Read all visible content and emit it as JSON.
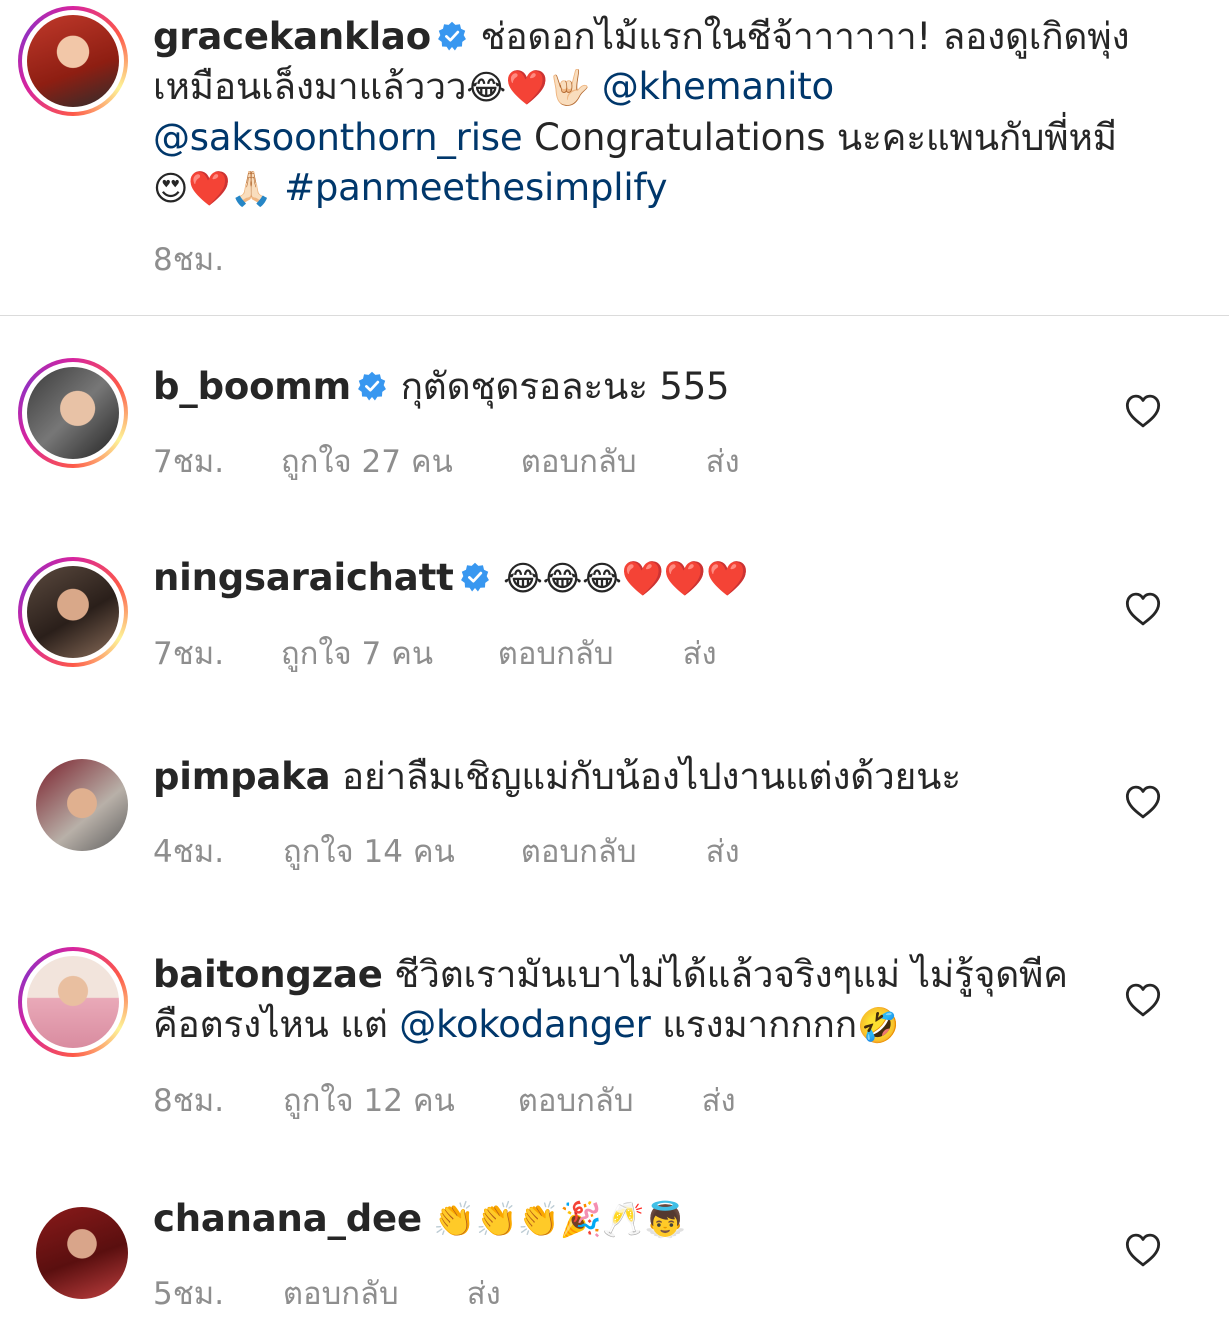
{
  "caption": {
    "username": "gracekanklao",
    "verified": true,
    "text_part1": "ช่อดอกไม้แรกในชีจ้าาาาาา! ลองดูเกิดพุ่งเหมือนเล็งมาแล้ววว",
    "emoji_part1": "😂❤️🤟🏻",
    "mention1": "@khemanito",
    "mention2": "@saksoonthorn_rise",
    "text_part2": "Congratulations นะคะแพนกับพี่หมี",
    "emoji_part2": "😍❤️🙏🏻",
    "hashtag": "#panmeethesimplify",
    "time": "8ชม."
  },
  "comments": [
    {
      "username": "b_boomm",
      "verified": true,
      "text": "กุตัดชุดรอละนะ 555",
      "time": "7ชม.",
      "likes": "ถูกใจ 27 คน",
      "reply": "ตอบกลับ",
      "send": "ส่ง",
      "avatar_ring": true
    },
    {
      "username": "ningsaraichatt",
      "verified": true,
      "text": "😂😂😂❤️❤️❤️",
      "time": "7ชม.",
      "likes": "ถูกใจ 7 คน",
      "reply": "ตอบกลับ",
      "send": "ส่ง",
      "avatar_ring": true
    },
    {
      "username": "pimpaka",
      "verified": false,
      "text": "อย่าลืมเชิญแม่กับน้องไปงานแต่งด้วยนะ",
      "time": "4ชม.",
      "likes": "ถูกใจ 14 คน",
      "reply": "ตอบกลับ",
      "send": "ส่ง",
      "avatar_ring": false
    },
    {
      "username": "baitongzae",
      "verified": false,
      "text": "ชีวิตเรามันเบาไม่ได้แล้วจริงๆแม่ ไม่รู้จุดพีคคือตรงไหน แต่",
      "mention": "@kokodanger",
      "text_after": "แรงมากกกก",
      "emoji": "🤣",
      "time": "8ชม.",
      "likes": "ถูกใจ 12 คน",
      "reply": "ตอบกลับ",
      "send": "ส่ง",
      "avatar_ring": true
    },
    {
      "username": "chanana_dee",
      "verified": false,
      "text": "👏👏👏🎉🥂👼",
      "time": "5ชม.",
      "reply": "ตอบกลับ",
      "send": "ส่ง",
      "avatar_ring": false
    }
  ],
  "colors": {
    "mention": "#00376b",
    "verified": "#3897f0",
    "meta": "#8e8e8e",
    "divider": "#dbdbdb"
  },
  "icons": {
    "verified": "verified-badge-icon",
    "like": "heart-outline-icon"
  }
}
